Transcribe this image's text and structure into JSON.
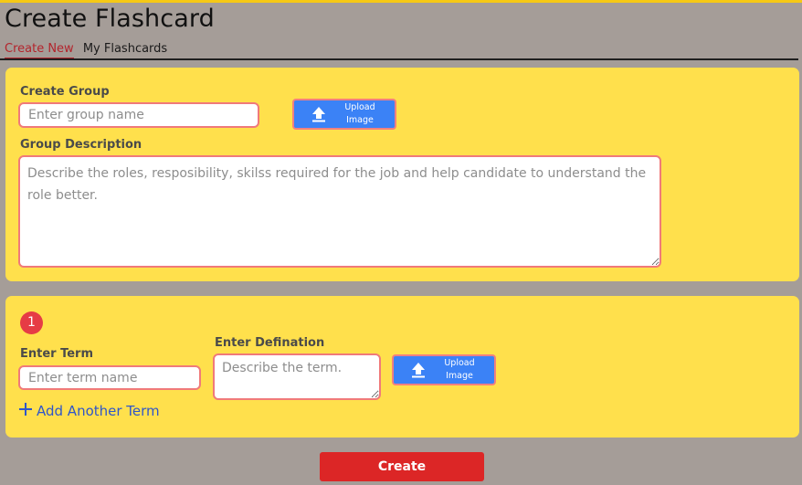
{
  "header": {
    "title": "Create Flashcard",
    "tabs": [
      {
        "label": "Create New",
        "active": true
      },
      {
        "label": "My Flashcards",
        "active": false
      }
    ]
  },
  "group": {
    "name_label": "Create Group",
    "name_placeholder": "Enter group name",
    "upload_label_line1": "Upload",
    "upload_label_line2": "Image",
    "description_label": "Group Description",
    "description_placeholder": "Describe the roles, resposibility, skilss required for the job and help candidate to understand the role better."
  },
  "terms": [
    {
      "number": "1",
      "term_label": "Enter Term",
      "term_placeholder": "Enter term name",
      "definition_label": "Enter Defination",
      "definition_placeholder": "Describe the term.",
      "upload_label_line1": "Upload",
      "upload_label_line2": "Image"
    }
  ],
  "add_term_label": "Add Another Term",
  "create_button_label": "Create",
  "icons": {
    "upload": "upload-icon",
    "add": "plus-icon"
  },
  "colors": {
    "background": "#a59d98",
    "card": "#ffe04c",
    "accent_blue": "#3b82f6",
    "input_border": "#f07a7a",
    "create_button": "#dc2626",
    "active_tab": "#b3242c",
    "badge": "#e63c45",
    "link": "#2f56c9"
  }
}
